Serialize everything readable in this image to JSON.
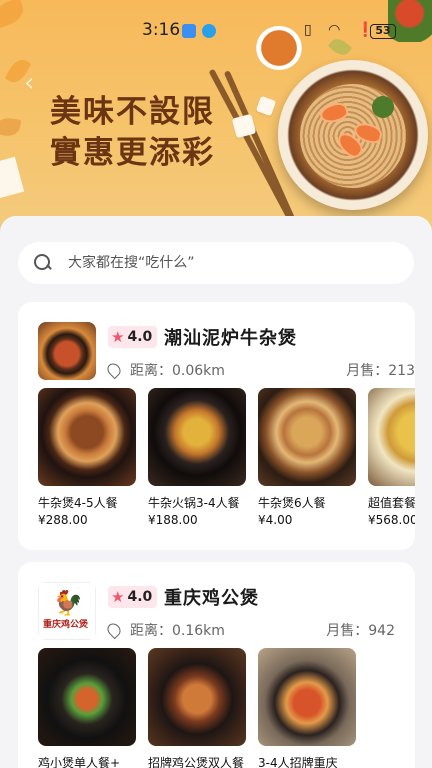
{
  "status_bar": {
    "time": "3:16",
    "battery": "53"
  },
  "banner": {
    "slogan_line1": "美味不設限",
    "slogan_line2": "實惠更添彩",
    "back_glyph": "‹"
  },
  "search": {
    "placeholder": "大家都在搜“吃什么”"
  },
  "shops": [
    {
      "rating": "4.0",
      "name": "潮汕泥炉牛杂煲",
      "distance": "距离：0.06km",
      "sales": "月售：213",
      "dishes": [
        {
          "name": "牛杂煲4-5人餐",
          "price": "¥288.00"
        },
        {
          "name": "牛杂火锅3-4人餐",
          "price": "¥188.00"
        },
        {
          "name": "牛杂煲6人餐",
          "price": "¥4.00"
        },
        {
          "name": "超值套餐",
          "price": "¥568.00"
        }
      ]
    },
    {
      "rating": "4.0",
      "name": "重庆鸡公煲",
      "logo_text": "重庆鸡公煲",
      "distance": "距离：0.16km",
      "sales": "月售：942",
      "dishes": [
        {
          "name": "鸡小煲单人餐+",
          "price": ""
        },
        {
          "name": "招牌鸡公煲双人餐",
          "price": ""
        },
        {
          "name": "3-4人招牌重庆",
          "price": ""
        }
      ]
    }
  ],
  "colors": {
    "banner": "#f7b95a",
    "slogan": "#6b3514",
    "rating_bg": "#fde7ec",
    "star": "#f2576e"
  }
}
